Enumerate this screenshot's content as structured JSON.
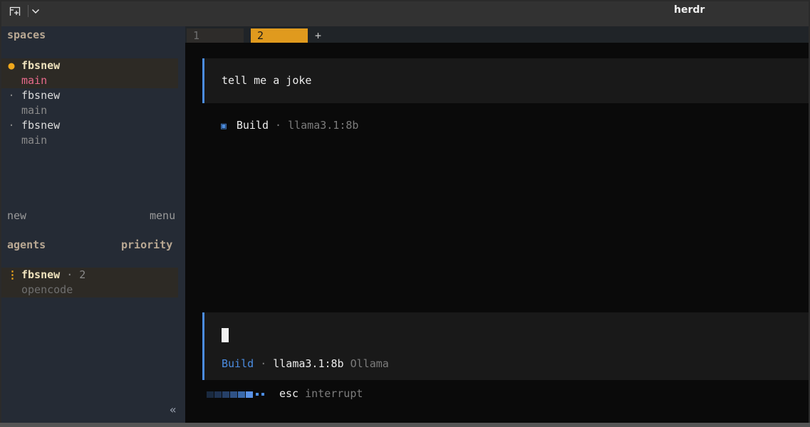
{
  "titlebar": {
    "app_title": "herdr",
    "new_tab_icon": "new-tab-icon",
    "menu_icon": "chevron-down-icon"
  },
  "sidebar": {
    "spaces_header": "spaces",
    "spaces": [
      {
        "bullet": "●",
        "name": "fbsnew",
        "branch": "main",
        "active": true
      },
      {
        "bullet": "·",
        "name": "fbsnew",
        "branch": "main",
        "active": false
      },
      {
        "bullet": "·",
        "name": "fbsnew",
        "branch": "main",
        "active": false
      }
    ],
    "new_label": "new",
    "menu_label": "menu",
    "agents_header": "agents",
    "priority_label": "priority",
    "agent": {
      "indicator": "⋮",
      "name": "fbsnew",
      "sep": "·",
      "count": "2",
      "tool": "opencode"
    },
    "collapse_glyph": "«"
  },
  "tabs": [
    {
      "label": "1",
      "active": false
    },
    {
      "label": "2",
      "active": true
    }
  ],
  "add_tab": "+",
  "conversation": {
    "prompt": "tell me a joke",
    "build_icon": "▣",
    "mode": "Build",
    "sep": "·",
    "model": "llama3.1:8b"
  },
  "input": {
    "mode": "Build",
    "sep": "·",
    "model": "llama3.1:8b",
    "provider": "Ollama"
  },
  "footer": {
    "key": "esc",
    "action": "interrupt"
  },
  "colors": {
    "accent_blue": "#4b8ce0",
    "active_tab": "#e09a1e",
    "active_dot": "#f0a81c",
    "branch_pink": "#e86a8b"
  }
}
